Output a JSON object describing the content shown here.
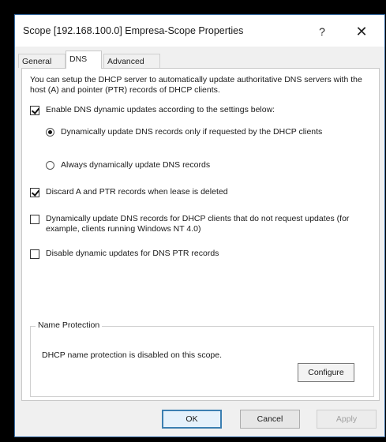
{
  "window": {
    "title": "Scope [192.168.100.0] Empresa-Scope Properties",
    "help_glyph": "?",
    "close_glyph": "✕"
  },
  "tabs": [
    {
      "label": "General",
      "active": false
    },
    {
      "label": "DNS",
      "active": true
    },
    {
      "label": "Advanced",
      "active": false
    }
  ],
  "dns": {
    "intro": "You can setup the DHCP server to automatically update authoritative DNS servers with the host (A) and pointer (PTR) records of DHCP clients.",
    "enable_updates": {
      "label": "Enable DNS dynamic updates according to the settings below:",
      "checked": true
    },
    "radio_requested": {
      "label": "Dynamically update DNS records only if requested by the DHCP clients",
      "checked": true
    },
    "radio_always": {
      "label": "Always dynamically update DNS records",
      "checked": false
    },
    "discard_records": {
      "label": "Discard A and PTR records when lease is deleted",
      "checked": true
    },
    "update_nonrequesting": {
      "label": "Dynamically update DNS records for DHCP clients that do not request updates (for example, clients running Windows NT 4.0)",
      "checked": false
    },
    "disable_ptr": {
      "label": "Disable dynamic updates for DNS PTR records",
      "checked": false
    }
  },
  "name_protection": {
    "title": "Name Protection",
    "status": "DHCP name protection is disabled on this scope.",
    "configure_label": "Configure"
  },
  "buttons": {
    "ok": "OK",
    "cancel": "Cancel",
    "apply": "Apply"
  },
  "colors": {
    "accent": "#3c7fb1",
    "window_border": "#3a6ea5"
  }
}
